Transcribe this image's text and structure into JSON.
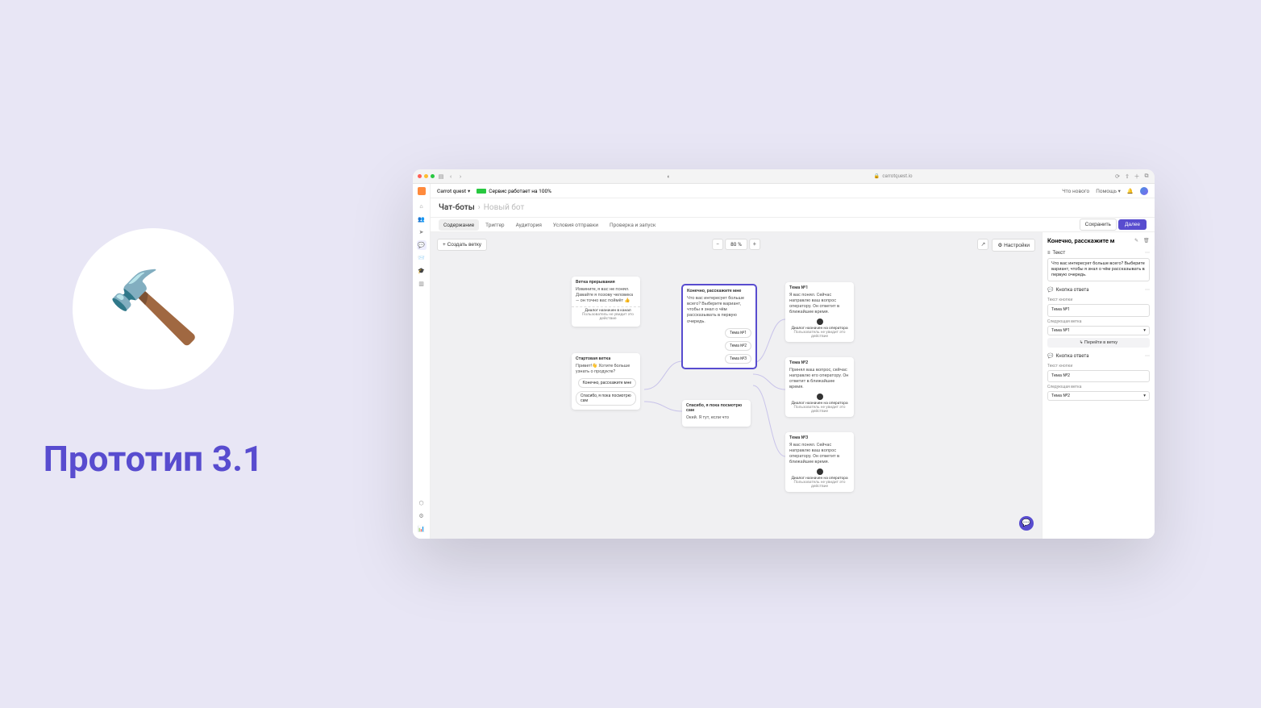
{
  "hero": {
    "title": "Прототип 3.1",
    "emoji": "🔨"
  },
  "browser": {
    "url": "carrotquest.io"
  },
  "topbar": {
    "project": "Carrot quest",
    "service_status": "Сервис работает на 100%",
    "whats_new": "Что нового",
    "help": "Помощь"
  },
  "breadcrumb": {
    "root": "Чат-боты",
    "current": "Новый бот"
  },
  "tabs": [
    "Содержание",
    "Триггер",
    "Аудитория",
    "Условия отправки",
    "Проверка и запуск"
  ],
  "actions": {
    "save": "Сохранить",
    "next": "Далее"
  },
  "toolbar": {
    "create_branch": "+ Создать ветку",
    "zoom": "80 %",
    "settings": "Настройки"
  },
  "nodes": {
    "interrupt": {
      "title": "Ветка прерывания",
      "msg": "Извините, я вас не понял. Давайте я позову человека — он точно вас поймёт 👍",
      "assign_title": "Диалог назначен в канал",
      "assign_sub": "Пользователь не увидит это действие"
    },
    "start": {
      "title": "Стартовая ветка",
      "msg": "Привет!👋\nХотите больше узнать о продукте?",
      "btn1": "Конечно, расскажите мне",
      "btn2": "Спасибо, я пока посмотрю сам"
    },
    "tell": {
      "title": "Конечно, расскажите мне",
      "msg": "Что вас интересует больше всего? Выберите вариант, чтобы я знал о чём рассказывать в первую очередь.",
      "btn1": "Тема №1",
      "btn2": "Тема №2",
      "btn3": "Тема №3"
    },
    "browse": {
      "title": "Спасибо, я пока посмотрю сам",
      "msg": "Окей. Я тут, если что"
    },
    "t1": {
      "title": "Тема №1",
      "msg": "Я вас понял. Сейчас направлю ваш вопрос оператору. Он ответит в ближайшее время.",
      "assign_title": "Диалог назначен на оператора",
      "assign_sub": "Пользователь не увидит это действие"
    },
    "t2": {
      "title": "Тема №2",
      "msg": "Принял ваш вопрос, сейчас направлю его оператору. Он ответит в ближайшее время.",
      "assign_title": "Диалог назначен на оператора",
      "assign_sub": "Пользователь не увидит это действие"
    },
    "t3": {
      "title": "Тема №3",
      "msg": "Я вас понял. Сейчас направлю ваш вопрос оператору. Он ответит в ближайшее время.",
      "assign_title": "Диалог назначен на оператора",
      "assign_sub": "Пользователь не увидит это действие"
    }
  },
  "inspector": {
    "title": "Конечно, расскажите м",
    "text_section": "Текст",
    "text_value": "Что вас интересует больше всего? Выберите вариант, чтобы я знал о чём рассказывать в первую очередь.",
    "answer_btn_section": "Кнопка ответа",
    "btn_text_label": "Текст кнопки",
    "next_branch_label": "Следующая ветка",
    "goto_branch": "↳ Перейти в ветку",
    "answers": [
      {
        "text": "Тема №1",
        "next": "Тема №1"
      },
      {
        "text": "Тема №2",
        "next": "Тема №2"
      }
    ]
  }
}
